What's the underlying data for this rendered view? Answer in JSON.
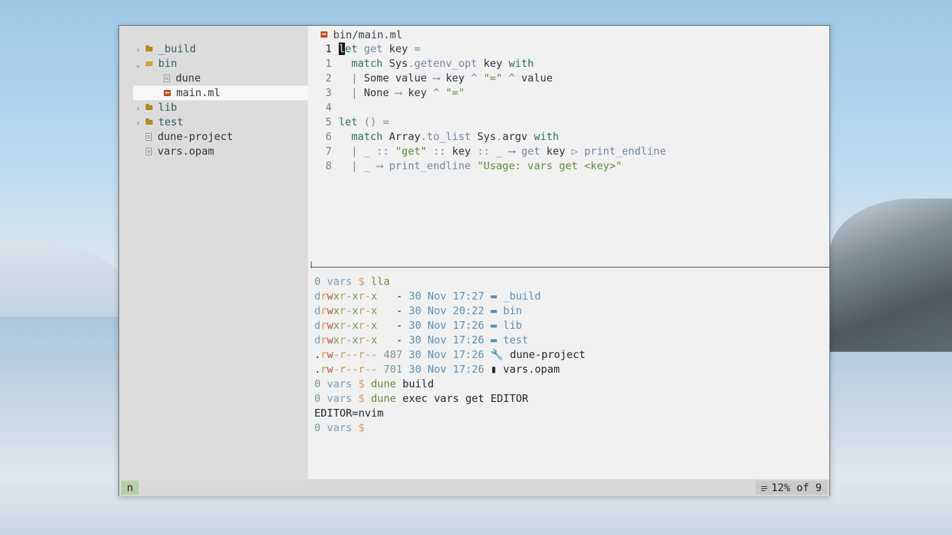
{
  "tree": [
    {
      "kind": "folder",
      "open": false,
      "chevron": "›",
      "label": "_build",
      "indent": 0
    },
    {
      "kind": "folder",
      "open": true,
      "chevron": "⌄",
      "label": "bin",
      "indent": 0
    },
    {
      "kind": "file",
      "open": false,
      "chevron": "",
      "label": "dune",
      "indent": 1
    },
    {
      "kind": "ml",
      "open": false,
      "chevron": "",
      "label": "main.ml",
      "indent": 1,
      "selected": true
    },
    {
      "kind": "folder",
      "open": false,
      "chevron": "›",
      "label": "lib",
      "indent": 0
    },
    {
      "kind": "folder",
      "open": false,
      "chevron": "›",
      "label": "test",
      "indent": 0
    },
    {
      "kind": "file",
      "open": false,
      "chevron": "",
      "label": "dune-project",
      "indent": 0
    },
    {
      "kind": "file",
      "open": false,
      "chevron": "",
      "label": "vars.opam",
      "indent": 0
    }
  ],
  "editor": {
    "tab_label": "bin/main.ml",
    "lines": [
      {
        "num": "1",
        "current": true,
        "tokens": [
          [
            "cursor",
            "l"
          ],
          [
            "kw",
            "et "
          ],
          [
            "fn",
            "get "
          ],
          [
            "mod",
            "key "
          ],
          [
            "op",
            "="
          ]
        ]
      },
      {
        "num": "1",
        "tokens": [
          [
            "mod",
            "  "
          ],
          [
            "kw",
            "match "
          ],
          [
            "mod",
            "Sys"
          ],
          [
            "op",
            "."
          ],
          [
            "fn",
            "getenv_opt "
          ],
          [
            "mod",
            "key "
          ],
          [
            "kw",
            "with"
          ]
        ]
      },
      {
        "num": "2",
        "tokens": [
          [
            "op",
            "  | "
          ],
          [
            "mod",
            "Some value "
          ],
          [
            "op",
            "⟶ "
          ],
          [
            "mod",
            "key "
          ],
          [
            "op",
            "^ "
          ],
          [
            "str",
            "\"=\" "
          ],
          [
            "op",
            "^ "
          ],
          [
            "mod",
            "value"
          ]
        ]
      },
      {
        "num": "3",
        "tokens": [
          [
            "op",
            "  | "
          ],
          [
            "mod",
            "None "
          ],
          [
            "op",
            "⟶ "
          ],
          [
            "mod",
            "key "
          ],
          [
            "op",
            "^ "
          ],
          [
            "str",
            "\"=\""
          ]
        ]
      },
      {
        "num": "4",
        "tokens": []
      },
      {
        "num": "5",
        "tokens": [
          [
            "kw",
            "let "
          ],
          [
            "op",
            "() ="
          ]
        ]
      },
      {
        "num": "6",
        "tokens": [
          [
            "mod",
            "  "
          ],
          [
            "kw",
            "match "
          ],
          [
            "mod",
            "Array"
          ],
          [
            "op",
            "."
          ],
          [
            "fn",
            "to_list "
          ],
          [
            "mod",
            "Sys"
          ],
          [
            "op",
            "."
          ],
          [
            "mod",
            "argv "
          ],
          [
            "kw",
            "with"
          ]
        ]
      },
      {
        "num": "7",
        "tokens": [
          [
            "op",
            "  | _ :: "
          ],
          [
            "str",
            "\"get\" "
          ],
          [
            "op",
            ":: "
          ],
          [
            "mod",
            "key "
          ],
          [
            "op",
            ":: _ ⟶ "
          ],
          [
            "fn",
            "get "
          ],
          [
            "mod",
            "key "
          ],
          [
            "op",
            "▷ "
          ],
          [
            "fn",
            "print_endline"
          ]
        ]
      },
      {
        "num": "8",
        "tokens": [
          [
            "op",
            "  | _ ⟶ "
          ],
          [
            "fn",
            "print_endline "
          ],
          [
            "str",
            "\"Usage: vars get <key>\""
          ]
        ]
      }
    ]
  },
  "terminal": {
    "lines": [
      [
        [
          "t-zero",
          "0 "
        ],
        [
          "t-dir",
          "vars "
        ],
        [
          "t-dollar",
          "$ "
        ],
        [
          "t-cmd",
          "lla"
        ]
      ],
      [
        [
          "p-d",
          "d"
        ],
        [
          "p-r",
          "r"
        ],
        [
          "p-w",
          "w"
        ],
        [
          "p-x",
          "x"
        ],
        [
          "p-r",
          "r"
        ],
        [
          "p-dash",
          "-"
        ],
        [
          "p-x",
          "x"
        ],
        [
          "p-r",
          "r"
        ],
        [
          "p-dash",
          "-"
        ],
        [
          "p-x",
          "x"
        ],
        [
          "t-dark",
          "   - "
        ],
        [
          "t-date",
          "30 Nov 17:27 "
        ],
        [
          "t-blue",
          "▬ _build"
        ]
      ],
      [
        [
          "p-d",
          "d"
        ],
        [
          "p-r",
          "r"
        ],
        [
          "p-w",
          "w"
        ],
        [
          "p-x",
          "x"
        ],
        [
          "p-r",
          "r"
        ],
        [
          "p-dash",
          "-"
        ],
        [
          "p-x",
          "x"
        ],
        [
          "p-r",
          "r"
        ],
        [
          "p-dash",
          "-"
        ],
        [
          "p-x",
          "x"
        ],
        [
          "t-dark",
          "   - "
        ],
        [
          "t-date",
          "30 Nov 20:22 "
        ],
        [
          "t-blue",
          "▬ bin"
        ]
      ],
      [
        [
          "p-d",
          "d"
        ],
        [
          "p-r",
          "r"
        ],
        [
          "p-w",
          "w"
        ],
        [
          "p-x",
          "x"
        ],
        [
          "p-r",
          "r"
        ],
        [
          "p-dash",
          "-"
        ],
        [
          "p-x",
          "x"
        ],
        [
          "p-r",
          "r"
        ],
        [
          "p-dash",
          "-"
        ],
        [
          "p-x",
          "x"
        ],
        [
          "t-dark",
          "   - "
        ],
        [
          "t-date",
          "30 Nov 17:26 "
        ],
        [
          "t-blue",
          "▬ lib"
        ]
      ],
      [
        [
          "p-d",
          "d"
        ],
        [
          "p-r",
          "r"
        ],
        [
          "p-w",
          "w"
        ],
        [
          "p-x",
          "x"
        ],
        [
          "p-r",
          "r"
        ],
        [
          "p-dash",
          "-"
        ],
        [
          "p-x",
          "x"
        ],
        [
          "p-r",
          "r"
        ],
        [
          "p-dash",
          "-"
        ],
        [
          "p-x",
          "x"
        ],
        [
          "t-dark",
          "   - "
        ],
        [
          "t-date",
          "30 Nov 17:26 "
        ],
        [
          "t-blue",
          "▬ test"
        ]
      ],
      [
        [
          "t-dark",
          "."
        ],
        [
          "p-r",
          "r"
        ],
        [
          "p-w",
          "w"
        ],
        [
          "p-dash",
          "-"
        ],
        [
          "p-r",
          "r"
        ],
        [
          "p-dash",
          "--"
        ],
        [
          "p-r",
          "r"
        ],
        [
          "p-dash",
          "-- "
        ],
        [
          "t-size",
          "487 "
        ],
        [
          "t-date",
          "30 Nov 17:26 "
        ],
        [
          "t-dark",
          "🔧 dune-project"
        ]
      ],
      [
        [
          "t-dark",
          "."
        ],
        [
          "p-r",
          "r"
        ],
        [
          "p-w",
          "w"
        ],
        [
          "p-dash",
          "-"
        ],
        [
          "p-r",
          "r"
        ],
        [
          "p-dash",
          "--"
        ],
        [
          "p-r",
          "r"
        ],
        [
          "p-dash",
          "-- "
        ],
        [
          "t-size",
          "701 "
        ],
        [
          "t-date",
          "30 Nov 17:26 "
        ],
        [
          "t-dark",
          "▮ vars.opam"
        ]
      ],
      [
        [
          "t-zero",
          "0 "
        ],
        [
          "t-dir",
          "vars "
        ],
        [
          "t-dollar",
          "$ "
        ],
        [
          "t-cmd",
          "dune "
        ],
        [
          "t-dark",
          "build"
        ]
      ],
      [
        [
          "t-zero",
          "0 "
        ],
        [
          "t-dir",
          "vars "
        ],
        [
          "t-dollar",
          "$ "
        ],
        [
          "t-cmd",
          "dune "
        ],
        [
          "t-dark",
          "exec vars get EDITOR"
        ]
      ],
      [
        [
          "t-dark",
          "EDITOR=nvim"
        ]
      ],
      [
        [
          "t-zero",
          "0 "
        ],
        [
          "t-dir",
          "vars "
        ],
        [
          "t-dollar",
          "$"
        ]
      ]
    ]
  },
  "status": {
    "mode": "n",
    "position": "12% of 9"
  }
}
